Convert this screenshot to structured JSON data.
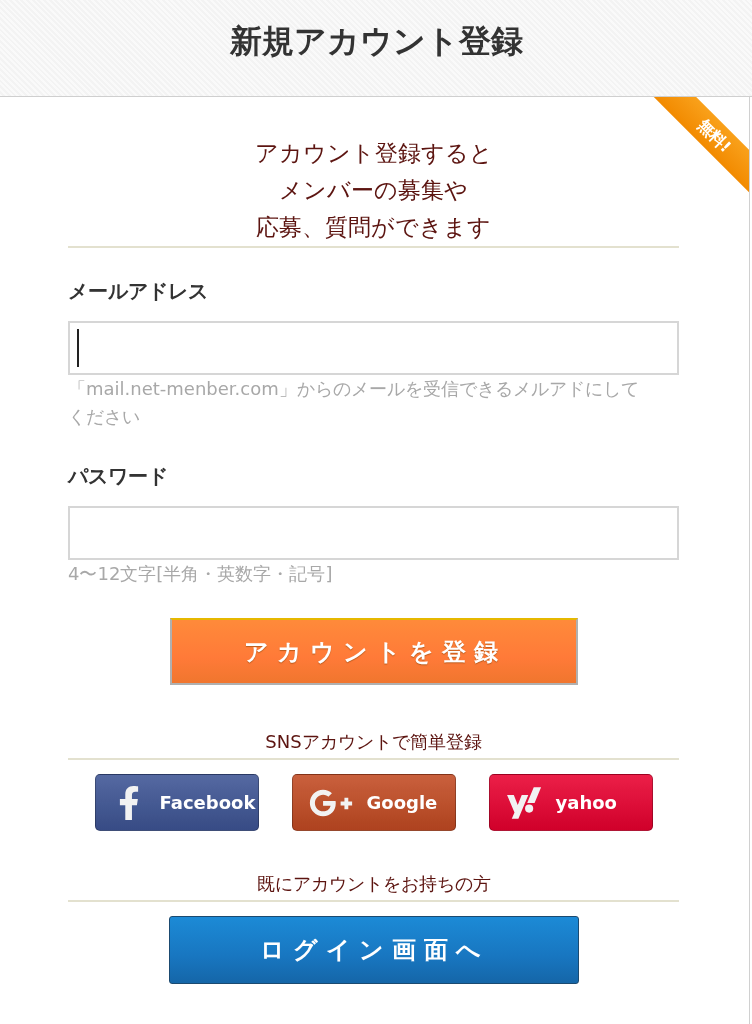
{
  "header": {
    "title": "新規アカウント登録"
  },
  "ribbon": {
    "label": "無料!"
  },
  "intro": [
    "アカウント登録すると",
    "メンバーの募集や",
    "応募、質問ができます"
  ],
  "fields": [
    {
      "label": "メールアドレス",
      "focused": true,
      "hint": "「mail.net-menber.com」からのメールを受信できるメルアドにしてください"
    },
    {
      "label": "パスワード",
      "focused": false,
      "hint": "4〜12文字[半角・英数字・記号]"
    }
  ],
  "submit_button": {
    "label": "アカウントを登録"
  },
  "sns": {
    "heading": "SNSアカウントで簡単登録",
    "buttons": [
      {
        "kind": "facebook",
        "label": "Facebook",
        "color": "#3d5494"
      },
      {
        "kind": "google",
        "label": "Google",
        "color": "#c24a22"
      },
      {
        "kind": "yahoo",
        "label": "yahoo",
        "color": "#e8002f"
      }
    ]
  },
  "login": {
    "heading": "既にアカウントをお持ちの方",
    "button": "ログイン画面へ"
  }
}
